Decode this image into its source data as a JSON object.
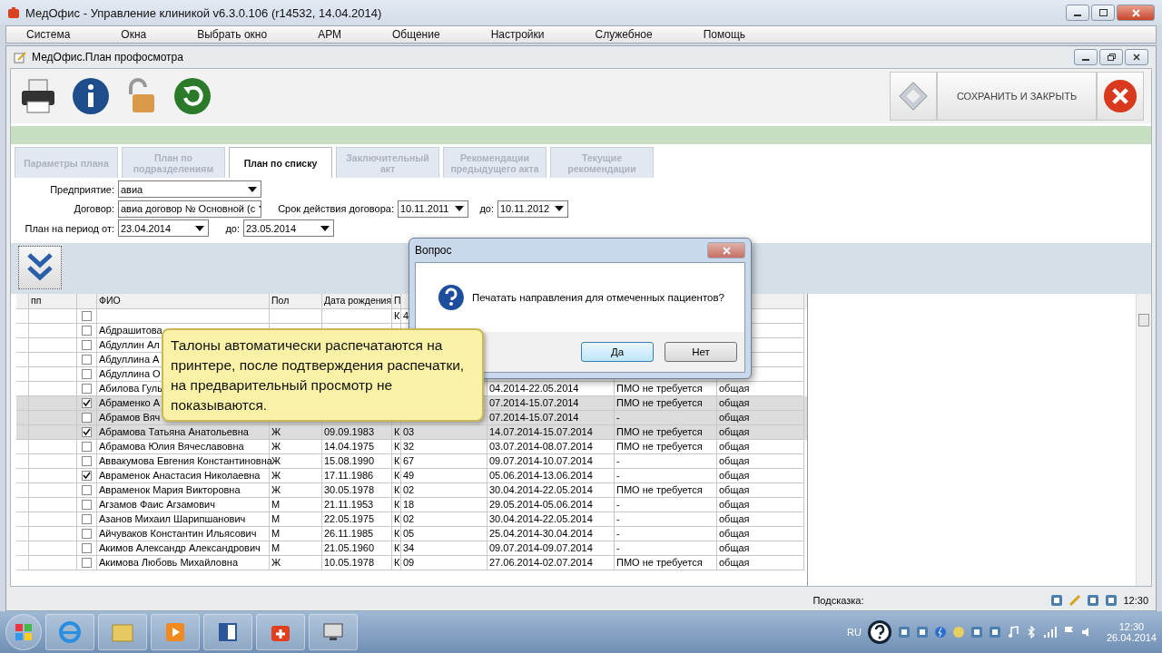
{
  "window": {
    "title": "МедОфис - Управление клиникой v6.3.0.106 (r14532, 14.04.2014)"
  },
  "menu": [
    "Система",
    "Окна",
    "Выбрать окно",
    "АРМ",
    "Общение",
    "Настройки",
    "Служебное",
    "Помощь"
  ],
  "child_window": {
    "title": "МедОфис.План профосмотра"
  },
  "toolbar": {
    "save_close": "СОХРАНИТЬ И ЗАКРЫТЬ"
  },
  "tabs": [
    {
      "label": "Параметры плана",
      "selected": false
    },
    {
      "label": "План по подразделениям",
      "selected": false
    },
    {
      "label": "План по списку",
      "selected": true
    },
    {
      "label": "Заключительный акт",
      "selected": false
    },
    {
      "label": "Рекомендации предыдущего акта",
      "selected": false
    },
    {
      "label": "Текущие рекомендации",
      "selected": false
    }
  ],
  "form": {
    "enterprise_label": "Предприятие:",
    "enterprise": "авиа",
    "contract_label": "Договор:",
    "contract": "авиа договор № Основной (с",
    "term_label": "Срок действия договора:",
    "term_from": "10.11.2011",
    "term_to_label": "до:",
    "term_to": "10.11.2012",
    "period_label": "План на период от:",
    "period_from": "23.04.2014",
    "period_to_label": "до:",
    "period_to": "23.05.2014"
  },
  "table": {
    "columns": [
      "пп",
      "ФИО",
      "Пол",
      "Дата рождения",
      "П"
    ],
    "rows": [
      {
        "checked": false,
        "selected": false,
        "k": "К",
        "code": "4"
      },
      {
        "checked": false,
        "selected": false,
        "name": "Абдрашитова"
      },
      {
        "checked": false,
        "selected": false,
        "name": "Абдуллин Ал"
      },
      {
        "checked": false,
        "selected": false,
        "name": "Абдуллина А"
      },
      {
        "checked": false,
        "selected": false,
        "name": "Абдуллина О"
      },
      {
        "checked": false,
        "selected": false,
        "name": "Абилова Гуль",
        "period": "04.2014-22.05.2014",
        "pmo": "ПМО не требуется",
        "type": "общая"
      },
      {
        "checked": true,
        "selected": true,
        "name": "Абраменко А",
        "period": "07.2014-15.07.2014",
        "pmo": "ПМО не требуется",
        "type": "общая"
      },
      {
        "checked": false,
        "selected": true,
        "name": "Абрамов Вяч",
        "period": "07.2014-15.07.2014",
        "pmo": "-",
        "type": "общая"
      },
      {
        "checked": true,
        "selected": true,
        "name": "Абрамова Татьяна Анатольевна",
        "sex": "Ж",
        "dob": "09.09.1983",
        "k": "К",
        "code": "03",
        "period": "14.07.2014-15.07.2014",
        "pmo": "ПМО не требуется",
        "type": "общая"
      },
      {
        "checked": false,
        "selected": false,
        "name": "Абрамова Юлия Вячеславовна",
        "sex": "Ж",
        "dob": "14.04.1975",
        "k": "К",
        "code": "32",
        "period": "03.07.2014-08.07.2014",
        "pmo": "ПМО не требуется",
        "type": "общая"
      },
      {
        "checked": false,
        "selected": false,
        "name": "Аввакумова Евгения Константиновна",
        "sex": "Ж",
        "dob": "15.08.1990",
        "k": "К",
        "code": "67",
        "period": "09.07.2014-10.07.2014",
        "pmo": "-",
        "type": "общая"
      },
      {
        "checked": true,
        "selected": false,
        "name": "Авраменок Анастасия Николаевна",
        "sex": "Ж",
        "dob": "17.11.1986",
        "k": "К",
        "code": "49",
        "period": "05.06.2014-13.06.2014",
        "pmo": "-",
        "type": "общая"
      },
      {
        "checked": false,
        "selected": false,
        "name": "Авраменок Мария Викторовна",
        "sex": "Ж",
        "dob": "30.05.1978",
        "k": "К",
        "code": "02",
        "period": "30.04.2014-22.05.2014",
        "pmo": "ПМО не требуется",
        "type": "общая"
      },
      {
        "checked": false,
        "selected": false,
        "name": "Агзамов Фаис Агзамович",
        "sex": "М",
        "dob": "21.11.1953",
        "k": "К",
        "code": "18",
        "period": "29.05.2014-05.06.2014",
        "pmo": "-",
        "type": "общая"
      },
      {
        "checked": false,
        "selected": false,
        "name": "Азанов Михаил Шарипшанович",
        "sex": "М",
        "dob": "22.05.1975",
        "k": "К",
        "code": "02",
        "period": "30.04.2014-22.05.2014",
        "pmo": "-",
        "type": "общая"
      },
      {
        "checked": false,
        "selected": false,
        "name": "Айчуваков Константин Ильясович",
        "sex": "М",
        "dob": "26.11.1985",
        "k": "К",
        "code": "05",
        "period": "25.04.2014-30.04.2014",
        "pmo": "-",
        "type": "общая"
      },
      {
        "checked": false,
        "selected": false,
        "name": "Акимов Александр Александрович",
        "sex": "М",
        "dob": "21.05.1960",
        "k": "К",
        "code": "34",
        "period": "09.07.2014-09.07.2014",
        "pmo": "-",
        "type": "общая"
      },
      {
        "checked": false,
        "selected": false,
        "name": "Акимова Любовь Михайловна",
        "sex": "Ж",
        "dob": "10.05.1978",
        "k": "К",
        "code": "09",
        "period": "27.06.2014-02.07.2014",
        "pmo": "ПМО не требуется",
        "type": "общая"
      }
    ]
  },
  "callout": {
    "text": "Талоны автоматически распечатаются на принтере, после подтверждения распечатки, на предварительный просмотр не показываются."
  },
  "dialog": {
    "title": "Вопрос",
    "message": "Печатать направления для отмеченных пациентов?",
    "buttons": [
      {
        "label": "Да",
        "selected": true
      },
      {
        "label": "Нет",
        "selected": false
      }
    ]
  },
  "status_bar": {
    "hint_label": "Подсказка:",
    "time": "12:30"
  },
  "taskbar": {
    "language": "RU",
    "time": "12:30",
    "date": "26.04.2014"
  }
}
